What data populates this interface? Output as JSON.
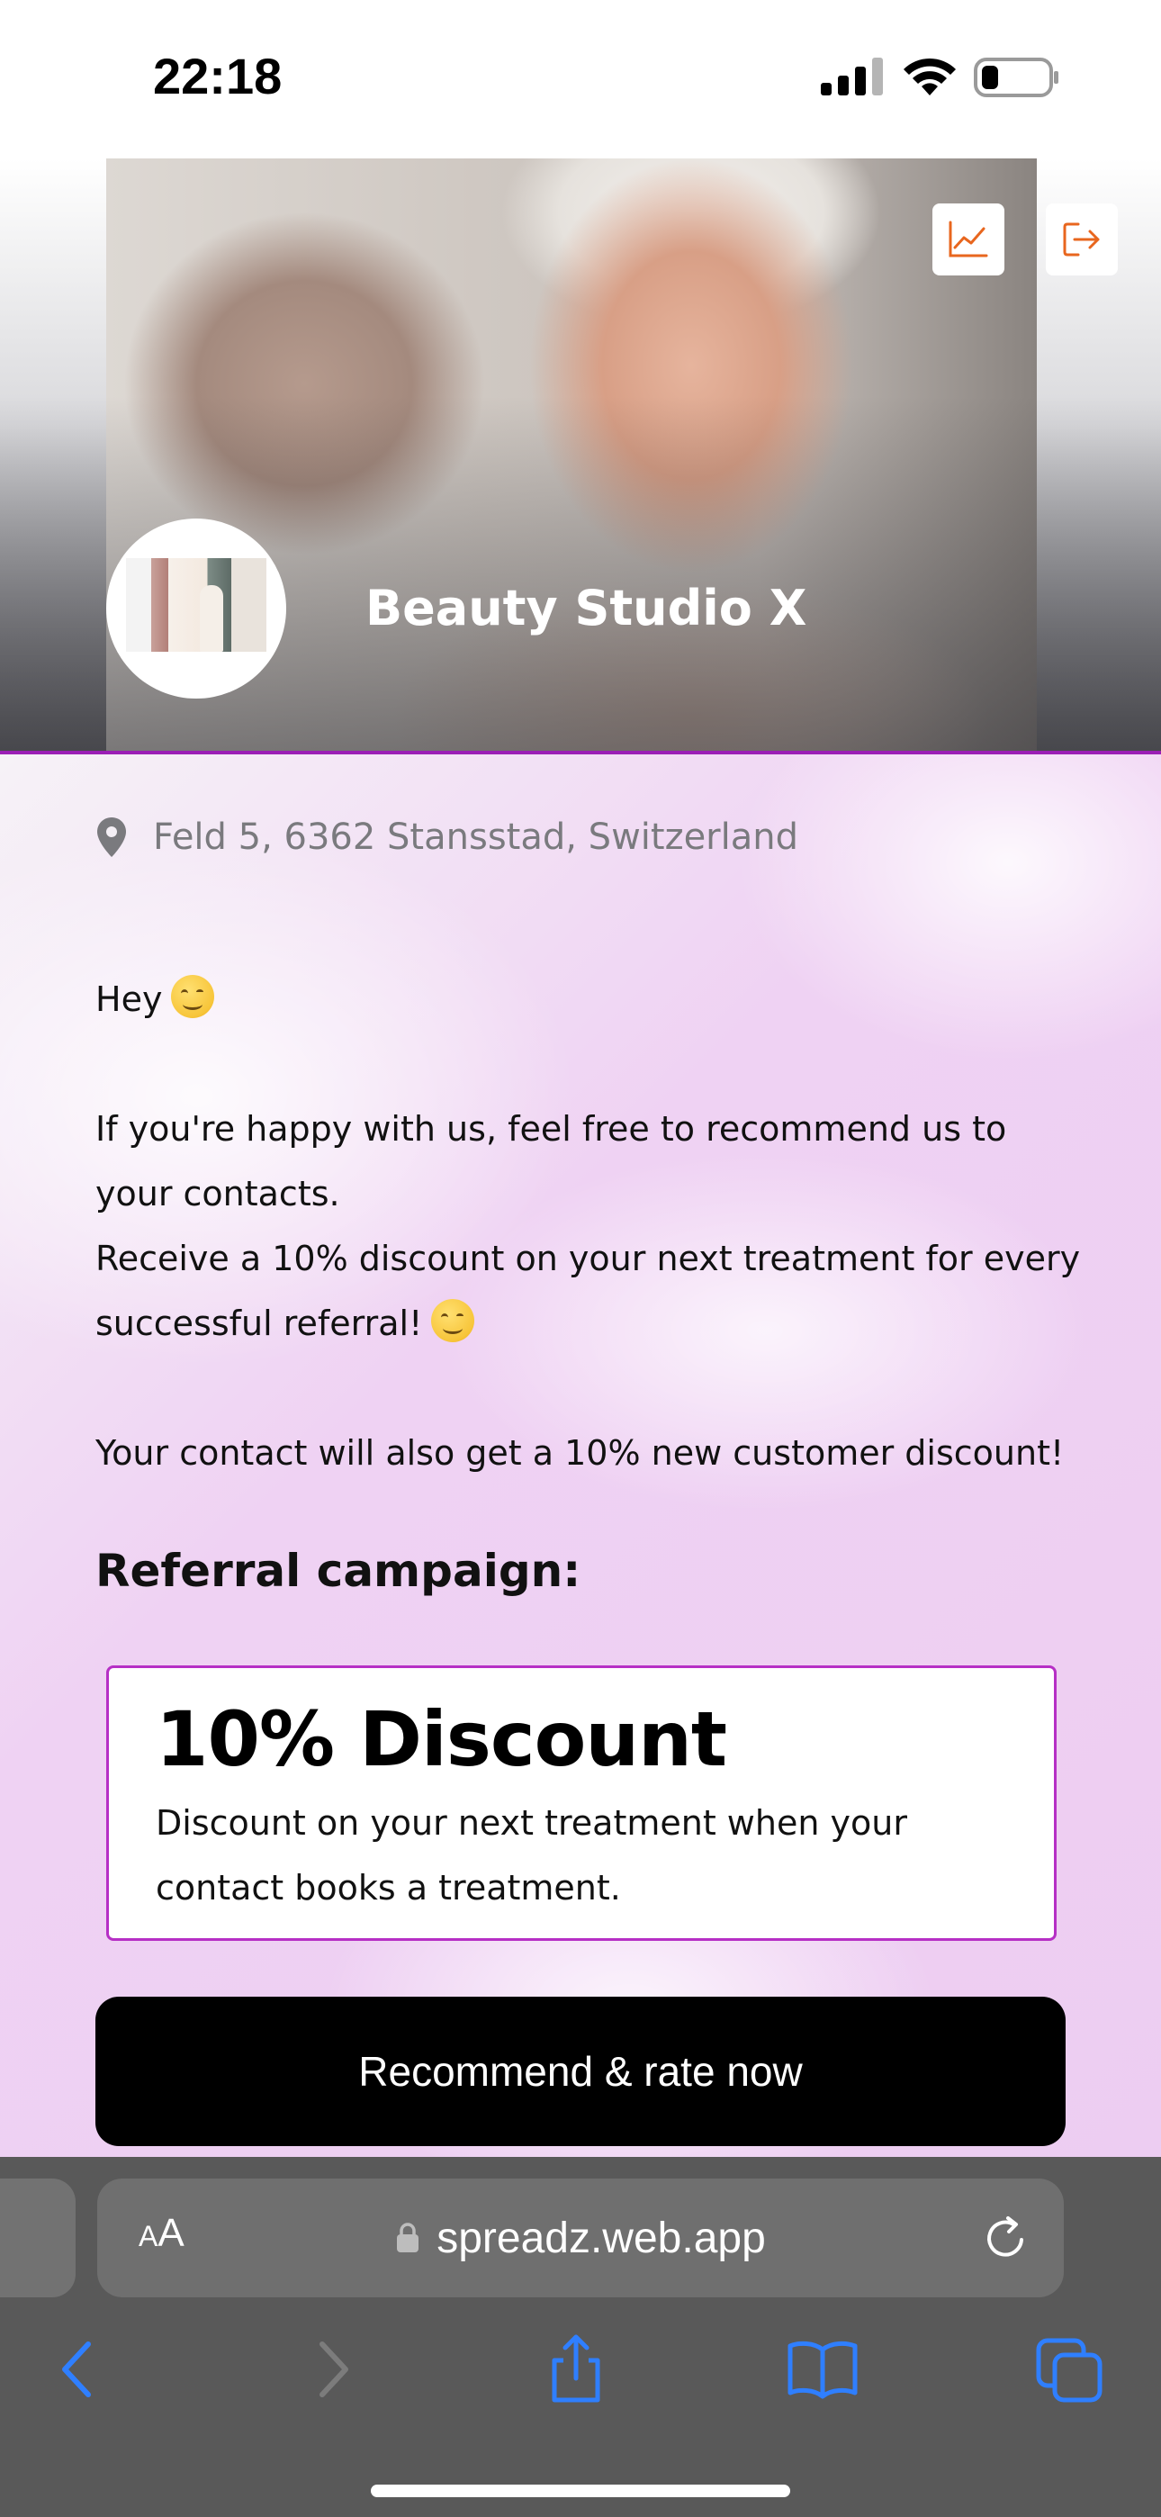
{
  "status_bar": {
    "time": "22:18"
  },
  "business": {
    "name": "Beauty Studio X",
    "address": "Feld 5, 6362 Stansstad, Switzerland"
  },
  "hero": {
    "stats_icon": "line-chart-icon",
    "logout_icon": "logout-icon",
    "accent_color": "#e8661e"
  },
  "message": {
    "greeting": "Hey",
    "line1": "If you're happy with us, feel free to recommend us to your contacts.",
    "line2": "Receive a 10% discount on your next treatment for every successful referral!",
    "line3": "Your contact will also get a 10% new customer discount!"
  },
  "campaign": {
    "heading": "Referral campaign:",
    "title": "10% Discount",
    "description": "Discount on your next treatment when your contact books a treatment.",
    "border_color": "#b62fc5"
  },
  "cta": {
    "label": "Recommend & rate now"
  },
  "browser": {
    "text_size_label_small": "A",
    "text_size_label_large": "A",
    "url": "spreadz.web.app",
    "accent_color": "#2f7fff"
  }
}
